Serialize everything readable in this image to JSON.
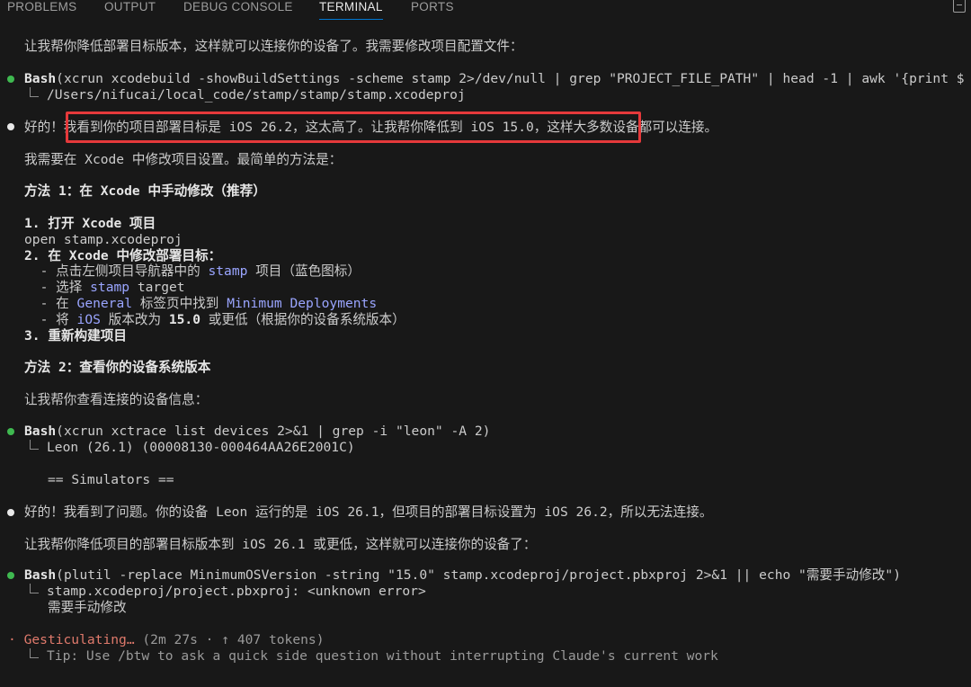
{
  "tabs": [
    {
      "label": "PROBLEMS",
      "active": false
    },
    {
      "label": "OUTPUT",
      "active": false
    },
    {
      "label": "DEBUG CONSOLE",
      "active": false
    },
    {
      "label": "TERMINAL",
      "active": true
    },
    {
      "label": "PORTS",
      "active": false
    }
  ],
  "colors": {
    "background": "#181818",
    "text": "#cccccc",
    "success_bullet": "#3fb950",
    "highlight_text": "#9aa5ff",
    "annotation_box": "#e5393b",
    "status_text": "#e07a6c"
  },
  "terminal": {
    "intro": "让我帮你降低部署目标版本，这样就可以连接你的设备了。我需要修改项目配置文件：",
    "bash1": {
      "label": "Bash",
      "command": "(xcrun xcodebuild -showBuildSettings -scheme stamp 2>/dev/null | grep \"PROJECT_FILE_PATH\" | head -1 | awk '{print $",
      "output": "/Users/nifucai/local_code/stamp/stamp/stamp.xcodeproj"
    },
    "msg1": {
      "prefix": "好的！",
      "highlighted": "我看到你的项目部署目标是 iOS 26.2，这太高了。让我帮你降低到 iOS 15.0，",
      "suffix": "这样大多数设备都可以连接。"
    },
    "p_xcode": "我需要在 Xcode 中修改项目设置。最简单的方法是：",
    "method1": "方法 1：在 Xcode 中手动修改（推荐）",
    "step1": "1. 打开 Xcode 项目",
    "step1_cmd": "open stamp.xcodeproj",
    "step2": "2. 在 Xcode 中修改部署目标：",
    "sub1": {
      "a": "  - 点击左侧项目导航器中的 ",
      "hl": "stamp",
      "b": " 项目（蓝色图标）"
    },
    "sub2": {
      "a": "  - 选择 ",
      "hl": "stamp",
      "b": " target"
    },
    "sub3": {
      "a": "  - 在 ",
      "hl": "General",
      "b": " 标签页中找到 ",
      "hl2": "Minimum Deployments"
    },
    "sub4": {
      "a": "  - 将 ",
      "hl": "iOS",
      "b": " 版本改为 ",
      "bold": "15.0",
      "c": " 或更低（根据你的设备系统版本）"
    },
    "step3": "3. 重新构建项目",
    "method2": "方法 2：查看你的设备系统版本",
    "p_check": "让我帮你查看连接的设备信息：",
    "bash2": {
      "label": "Bash",
      "command": "(xcrun xctrace list devices 2>&1 | grep -i \"leon\" -A 2)",
      "output": "Leon (26.1) (00008130-000464AA26E2001C)",
      "sim": "== Simulators =="
    },
    "msg2": "好的！我看到了问题。你的设备 Leon 运行的是 iOS 26.1，但项目的部署目标设置为 iOS 26.2，所以无法连接。",
    "p_lower": "让我帮你降低项目的部署目标版本到 iOS 26.1 或更低，这样就可以连接你的设备了：",
    "bash3": {
      "label": "Bash",
      "command": "(plutil -replace MinimumOSVersion -string \"15.0\" stamp.xcodeproj/project.pbxproj 2>&1 || echo \"需要手动修改\")",
      "output1": "stamp.xcodeproj/project.pbxproj: <unknown error>",
      "output2": "需要手动修改"
    },
    "status": {
      "icon": "·",
      "label": "Gesticulating…",
      "detail": " (2m 27s · ↑ 407 tokens)",
      "tip": "Tip: Use /btw to ask a quick side question without interrupting Claude's current work"
    }
  }
}
